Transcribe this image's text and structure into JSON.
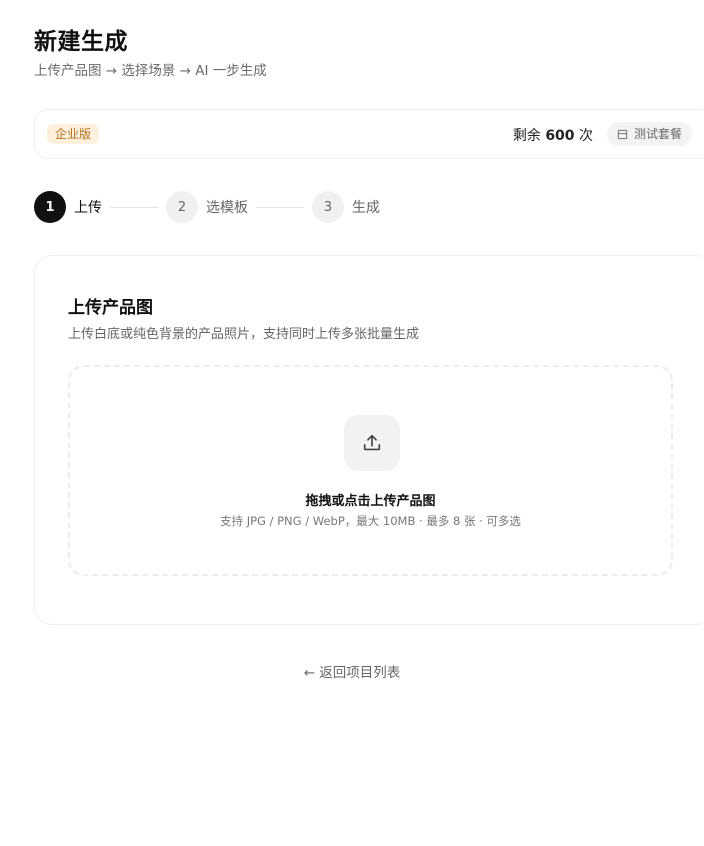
{
  "header": {
    "title": "新建生成",
    "subtitle": "上传产品图 → 选择场景 → AI 一步生成"
  },
  "plan": {
    "badge": "企业版",
    "quota_prefix": "剩余",
    "quota_count": "600",
    "quota_suffix": "次",
    "test_plan_label": "测试套餐",
    "badge_color": "#b5701e"
  },
  "steps": [
    {
      "number": "1",
      "label": "上传",
      "active": true
    },
    {
      "number": "2",
      "label": "选模板",
      "active": false
    },
    {
      "number": "3",
      "label": "生成",
      "active": false
    }
  ],
  "upload_card": {
    "title": "上传产品图",
    "description": "上传白底或纯色背景的产品照片，支持同时上传多张批量生成",
    "dropzone_title": "拖拽或点击上传产品图",
    "dropzone_hint": "支持 JPG / PNG / WebP，最大 10MB · 最多 8 张 · 可多选",
    "icon": "upload-icon"
  },
  "footer": {
    "back_link": "← 返回项目列表"
  }
}
